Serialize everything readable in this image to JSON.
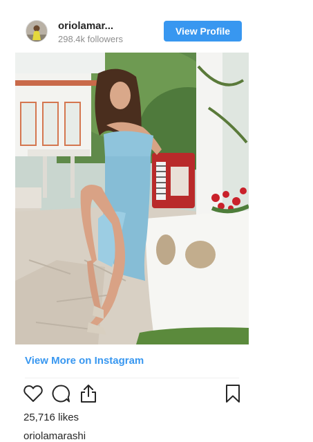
{
  "header": {
    "username": "oriolamar...",
    "followers": "298.4k followers",
    "view_profile_label": "View Profile"
  },
  "post": {
    "photo": "woman-in-blue-dress-with-red-accordion",
    "view_more_label": "View More on Instagram",
    "likes": "25,716 likes",
    "caption_username": "oriolamarashi"
  },
  "actions": {
    "like": "heart-icon",
    "comment": "comment-bubble-icon",
    "share": "share-icon",
    "save": "bookmark-icon"
  },
  "colors": {
    "accent": "#3897f0",
    "text": "#262626",
    "muted": "#8e8e8e",
    "dress": "#8fc4dc",
    "accordion": "#c0302c"
  }
}
